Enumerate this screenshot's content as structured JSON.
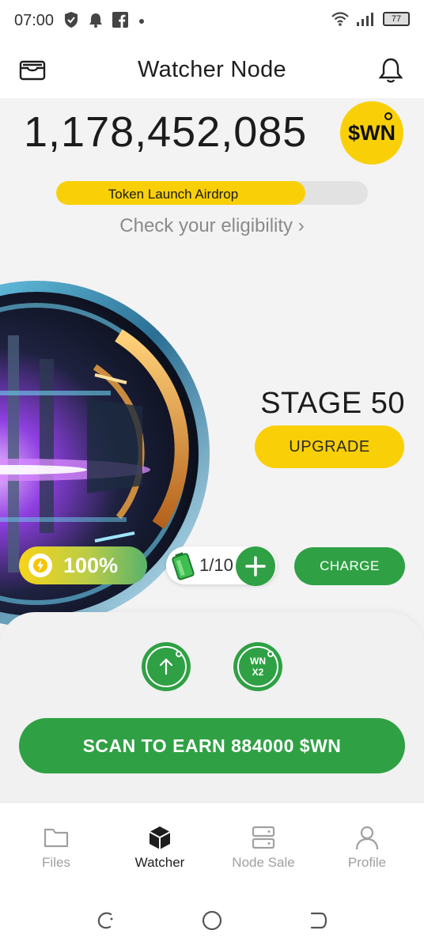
{
  "status_bar": {
    "time": "07:00",
    "battery": "77",
    "icons": [
      "shield-icon",
      "notification-icon",
      "facebook-icon",
      "dot-icon",
      "wifi-icon",
      "signal-icon",
      "battery-icon"
    ]
  },
  "header": {
    "title": "Watcher Node",
    "left_icon": "wallet-icon",
    "right_icon": "bell-icon"
  },
  "balance": {
    "value": "1,178,452,085",
    "token_badge": "$WN"
  },
  "airdrop": {
    "label": "Token Launch Airdrop",
    "progress": 0.8,
    "link": "Check your eligibility ›"
  },
  "node": {
    "stage": "STAGE 50",
    "upgrade_label": "UPGRADE"
  },
  "energy": {
    "value": "100%",
    "battery_count": "1/10",
    "charge_label": "CHARGE"
  },
  "actions": {
    "boost_badge": "WN\nX2",
    "scan_label": "SCAN TO EARN 884000 $WN"
  },
  "nav": {
    "items": [
      {
        "label": "Files",
        "icon": "folder-icon",
        "active": false
      },
      {
        "label": "Watcher",
        "icon": "cube-icon",
        "active": true
      },
      {
        "label": "Node Sale",
        "icon": "server-icon",
        "active": false
      },
      {
        "label": "Profile",
        "icon": "user-icon",
        "active": false
      }
    ]
  },
  "colors": {
    "accent_yellow": "#f9d007",
    "accent_green": "#2fa144",
    "background": "#f3f3f3"
  }
}
